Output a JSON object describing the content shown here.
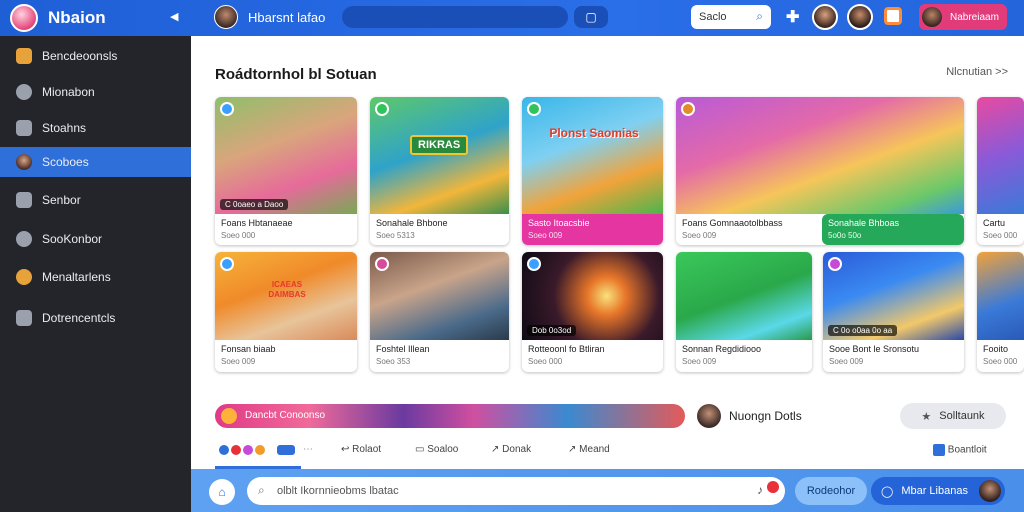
{
  "app": {
    "title": "Nbaion",
    "channel": "Hbarsnt lafao"
  },
  "topbar": {
    "search_value": "Saclo",
    "user_chip_label": "Nabreiaam",
    "plus_icon": "plus-icon",
    "search_icon": "search-icon"
  },
  "sidebar": {
    "items": [
      {
        "label": "Bencdeoonsls",
        "icon": "folder-icon"
      },
      {
        "label": "Mionabon",
        "icon": "compass-icon"
      },
      {
        "label": "Stoahns",
        "icon": "home-icon"
      },
      {
        "label": "Scoboes",
        "icon": "user-icon",
        "active": true
      },
      {
        "label": "Senbor",
        "icon": "monitor-icon"
      },
      {
        "label": "SooKonbor",
        "icon": "clock-icon"
      },
      {
        "label": "Menaltarlens",
        "icon": "people-icon"
      },
      {
        "label": "Dotrencentcls",
        "icon": "document-icon"
      }
    ]
  },
  "main": {
    "section_title": "Roádtornhol bl Sotuan",
    "more_link": "Nlcnutian  >>",
    "row1": [
      {
        "title": "Foans Hbtanaeae",
        "meta": "Soeo 000",
        "badge": "C 0oaeo a Daoo"
      },
      {
        "title": "Sonahale Bhbone",
        "meta": "Soeo 5313",
        "overlay_title": "RIKRAS"
      },
      {
        "title": "Sasto Itoacsbie",
        "meta": "Soeo 009",
        "overlay_title": "Plonst Saomias"
      },
      {
        "title": "Foans Gomnaaotolbbass",
        "meta": "Soeo 009"
      },
      {
        "title": "Sonahale Bhboas",
        "meta": "5o0o 50o"
      },
      {
        "title": "Cartu",
        "meta": "Soeo 000"
      }
    ],
    "row2": [
      {
        "title": "Fonsan biaab",
        "meta": "Soeo 009",
        "overlay_title": "ICAEAS DAIMBAS"
      },
      {
        "title": "Foshtel Illean",
        "meta": "Soeo 353"
      },
      {
        "title": "Rotteoonl fo Btliran",
        "meta": "Soeo 000",
        "badge": "Dob 0o3od"
      },
      {
        "title": "Sonnan Regdidiooo",
        "meta": "Soeo 009"
      },
      {
        "title": "Sooe Bont le Sronsotu",
        "meta": "Soeo 009",
        "badge": "C 0o o0aa 0o aa"
      },
      {
        "title": "Fooito",
        "meta": "Soeo 000"
      }
    ],
    "strip_label": "Dancbt Conoonso",
    "creator_name": "Nuongn Dotls",
    "follow_label": "Solltaunk",
    "actions": {
      "reply": "Rolaot",
      "save": "Soaloo",
      "thumb": "Donak",
      "share": "Meand",
      "report": "Boantloit"
    }
  },
  "bottombar": {
    "placeholder": "olblt Ikornnieobms lbatac",
    "pill1": "Rodeohor",
    "pill2": "Mbar Libanas"
  },
  "colors": {
    "brand_blue": "#2a6ee8",
    "sidebar_bg": "#23252b",
    "active_item": "#2f6fd9",
    "user_chip": "#e23b7a"
  }
}
